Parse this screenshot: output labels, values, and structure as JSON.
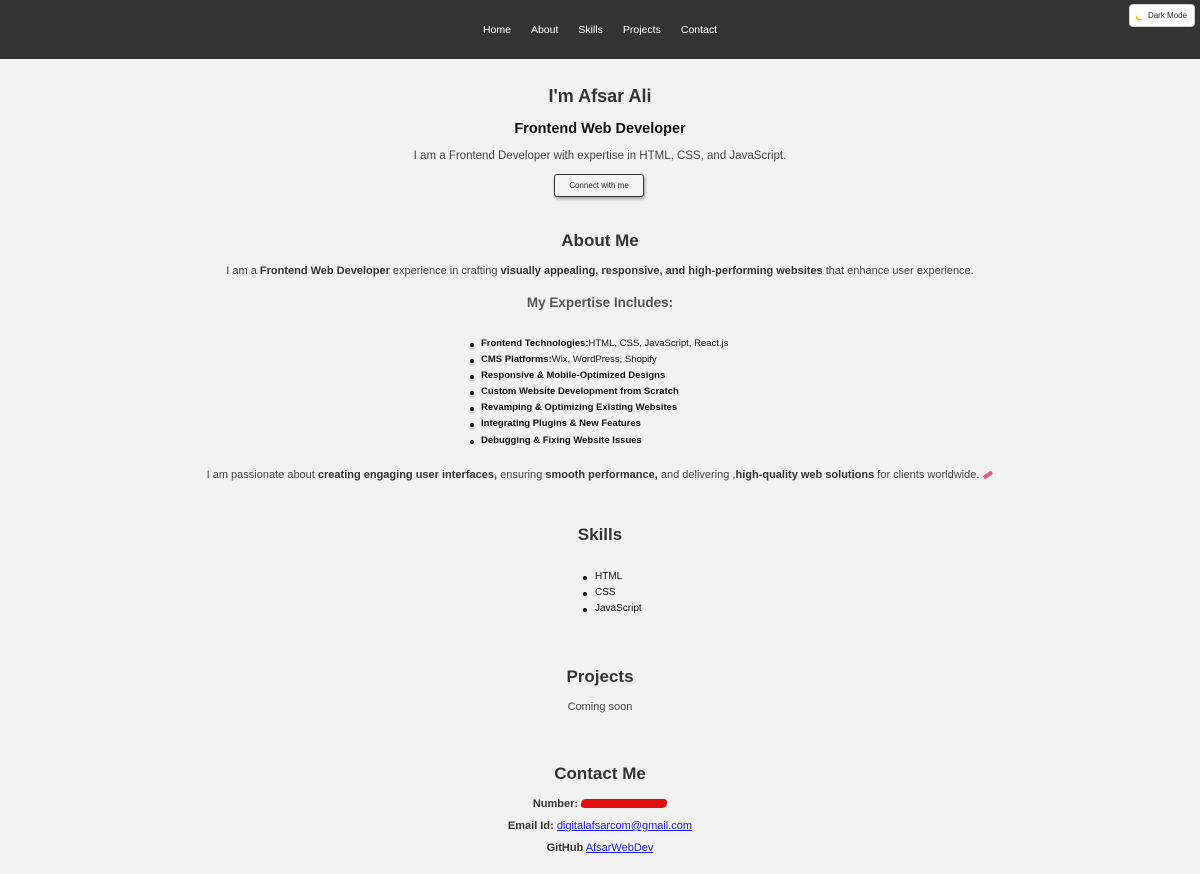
{
  "nav": {
    "links": [
      "Home",
      "About",
      "Skills",
      "Projects",
      "Contact"
    ],
    "bg": "#333333"
  },
  "theme_toggle": {
    "label": "Dark Mode",
    "icon": "moon-icon"
  },
  "hero": {
    "name": "I'm Afsar Ali",
    "role": "Frontend Web Developer",
    "tagline": "I am a Frontend Developer with expertise in HTML, CSS, and JavaScript.",
    "cta": "Connect with me"
  },
  "about": {
    "title": "About Me",
    "intro": {
      "p1": "I am a ",
      "b1": "Frontend Web Developer",
      "p2": " experience in crafting ",
      "b2": "visually appealing, responsive, and high-performing websites",
      "p3": " that enhance user experience."
    },
    "expertise_title": "My Expertise Includes:",
    "expertise": [
      {
        "bold": "Frontend Technologies:",
        "text": "HTML, CSS, JavaScript, React.js"
      },
      {
        "bold": "CMS Platforms:",
        "text": "Wix, WordPress, Shopify"
      },
      {
        "bold": "Responsive & Mobile-Optimized Designs",
        "text": ""
      },
      {
        "bold": "Custom Website Development from Scratch",
        "text": ""
      },
      {
        "bold": "Revamping & Optimizing Existing Websites",
        "text": ""
      },
      {
        "bold": "Integrating Plugins & New Features",
        "text": ""
      },
      {
        "bold": "Debugging & Fixing Website Issues",
        "text": ""
      }
    ],
    "outro": {
      "p1": "I am passionate about ",
      "b1": "creating engaging user interfaces,",
      "p2": " ensuring ",
      "b2": "smooth performance,",
      "p3": " and delivering ,",
      "b3": "high-quality web solutions",
      "p4": " for clients worldwide.",
      "icon": "rocket-icon"
    }
  },
  "skills": {
    "title": "Skills",
    "items": [
      "HTML",
      "CSS",
      "JavaScript"
    ]
  },
  "projects": {
    "title": "Projects",
    "text": "Coming soon"
  },
  "contact": {
    "title": "Contact Me",
    "number_label": "Number:",
    "email_label": "Email Id:",
    "email": "digitalafsarcom@gmail.com",
    "github_label": "GitHub",
    "github": "AfsarWebDev"
  }
}
